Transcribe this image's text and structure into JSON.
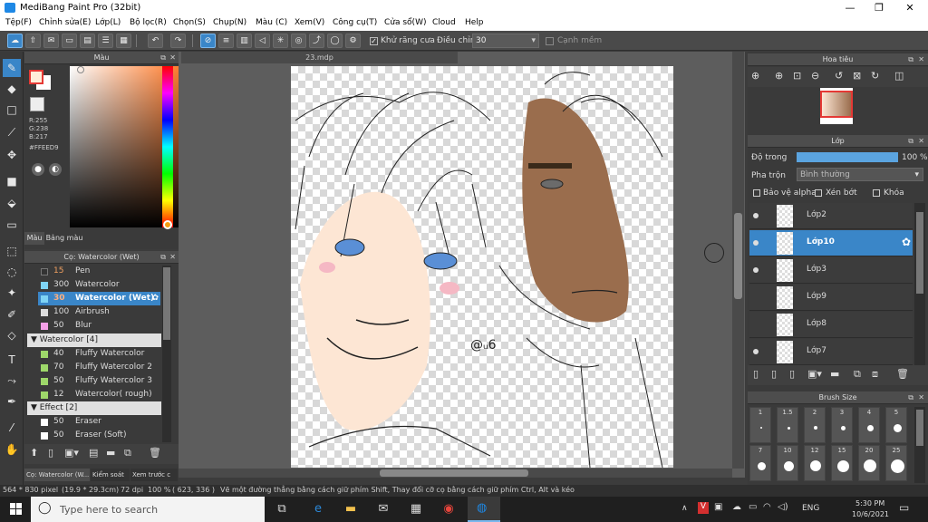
{
  "app": {
    "title": "MediBang Paint Pro (32bit)",
    "min": "—",
    "max": "❐",
    "close": "✕"
  },
  "menu": [
    "Tệp(F)",
    "Chỉnh sửa(E)",
    "Lớp(L)",
    "Bộ lọc(R)",
    "Chọn(S)",
    "Chụp(N)",
    "Màu (C)",
    "Xem(V)",
    "Công cụ(T)",
    "Cửa sổ(W)",
    "Cloud",
    "Help"
  ],
  "toolbar": {
    "antialias_label": "Khử răng cưa",
    "adjust_label": "Điều chỉnh",
    "adjust_value": "30",
    "smooth_label": "Cạnh mềm"
  },
  "color_panel": {
    "title": "Màu",
    "r": "R:255",
    "g": "G:238",
    "b": "B:217",
    "hex": "#FFEED9",
    "tab_color": "Màu",
    "tab_palette": "Bảng màu",
    "fg": "#FFEED9",
    "bg": "#ffffff"
  },
  "brush_panel": {
    "title": "Cọ: Watercolor (Wet)",
    "items": [
      {
        "size": "15",
        "name": "Pen",
        "color": "#333333"
      },
      {
        "size": "300",
        "name": "Watercolor",
        "color": "#7fd4f5"
      },
      {
        "size": "30",
        "name": "Watercolor (Wet)",
        "color": "#7fd4f5"
      },
      {
        "size": "100",
        "name": "Airbrush",
        "color": "#dddddd"
      },
      {
        "size": "50",
        "name": "Blur",
        "color": "#f5a0e8"
      }
    ],
    "group2": "Watercolor [4]",
    "items2": [
      {
        "size": "40",
        "name": "Fluffy Watercolor",
        "color": "#9ed86a"
      },
      {
        "size": "70",
        "name": "Fluffy Watercolor 2",
        "color": "#9ed86a"
      },
      {
        "size": "50",
        "name": "Fluffy Watercolor 3",
        "color": "#9ed86a"
      },
      {
        "size": "12",
        "name": "Watercolor( rough)",
        "color": "#9ed86a"
      }
    ],
    "group3": "Effect [2]",
    "items3": [
      {
        "size": "50",
        "name": "Eraser",
        "color": "#ffffff"
      },
      {
        "size": "50",
        "name": "Eraser (Soft)",
        "color": "#ffffff"
      }
    ],
    "bottom_tabs": [
      "Cọ: Watercolor (W...",
      "Kiểm soát",
      "Xem trước c"
    ]
  },
  "document": {
    "tab": "23.mdp"
  },
  "navigator": {
    "title": "Hoa tiêu"
  },
  "layers": {
    "title": "Lớp",
    "opacity_label": "Độ trong",
    "opacity_value": "100 %",
    "blend_label": "Pha trộn",
    "blend_value": "Bình thường",
    "protect_alpha": "Bảo vệ alpha",
    "clip": "Xén bớt",
    "lock": "Khóa",
    "items": [
      {
        "name": "Lớp2"
      },
      {
        "name": "Lớp10"
      },
      {
        "name": "Lớp3"
      },
      {
        "name": "Lớp9"
      },
      {
        "name": "Lớp8"
      },
      {
        "name": "Lớp7"
      }
    ]
  },
  "brush_size": {
    "title": "Brush Size",
    "sizes": [
      "1",
      "1.5",
      "2",
      "3",
      "4",
      "5",
      "7",
      "10",
      "12",
      "15",
      "20",
      "25"
    ]
  },
  "status": {
    "size": "564 * 830 pixel",
    "cm": "(19.9 * 29.3cm)",
    "dpi": "72 dpi",
    "zoom": "100 %",
    "coord": "( 623, 336 )",
    "hint": "Vẽ một đường thẳng bằng cách giữ phím Shift, Thay đổi cỡ cọ bằng cách giữ phím Ctrl, Alt và kéo"
  },
  "taskbar": {
    "search": "Type here to search",
    "lang": "ENG",
    "time": "5:30 PM",
    "date": "10/6/2021"
  }
}
